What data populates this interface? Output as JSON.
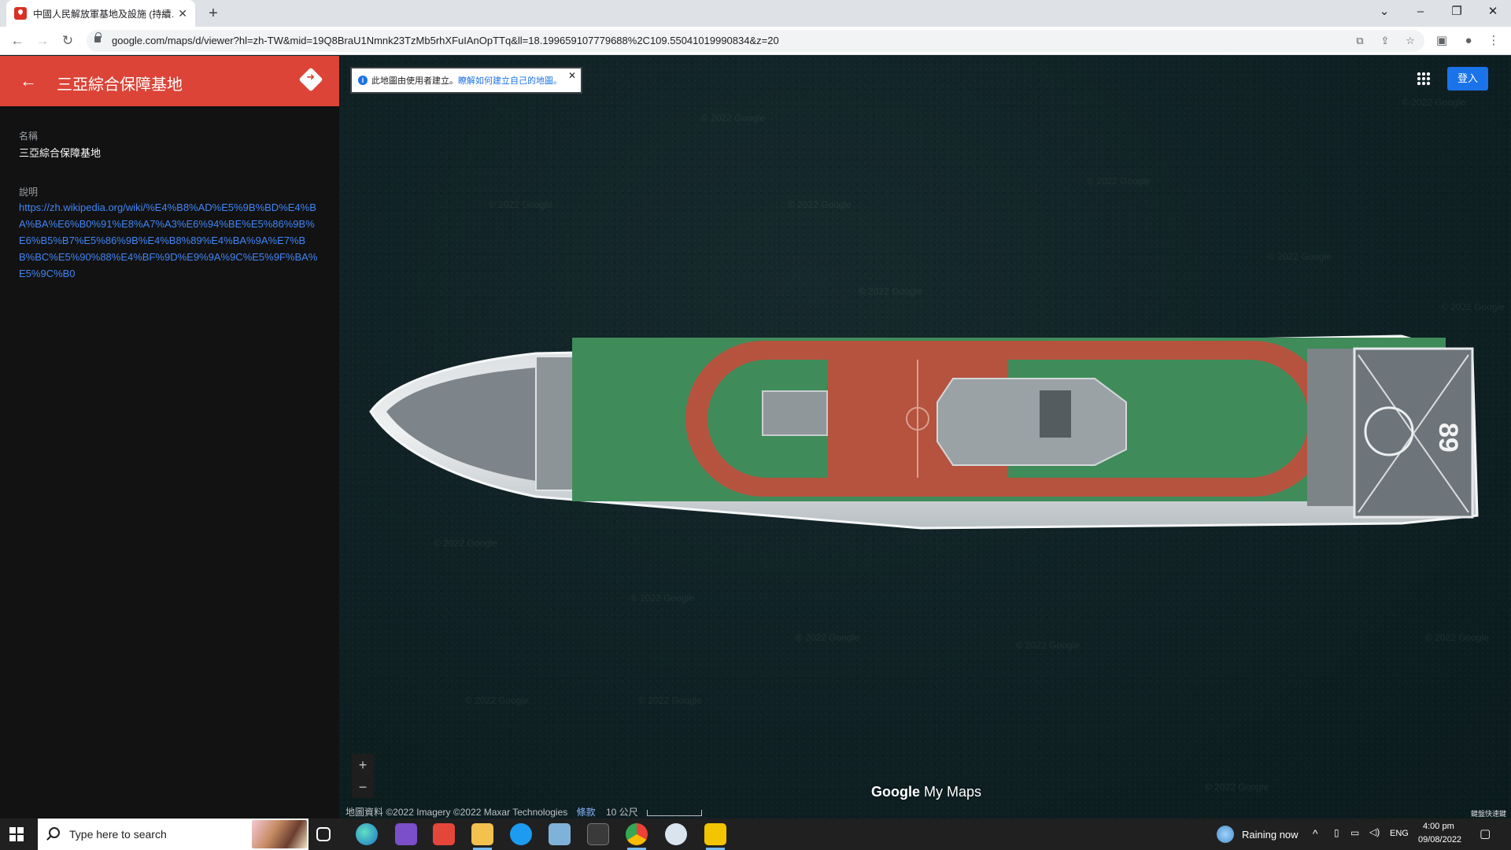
{
  "browser": {
    "tab_title": "中國人民解放軍基地及設施 (持續…",
    "url": "google.com/maps/d/viewer?hl=zh-TW&mid=19Q8BraU1Nmnk23TzMb5rhXFuIAnOpTTq&ll=18.199659107779688%2C109.55041019990834&z=20"
  },
  "panel": {
    "title": "三亞綜合保障基地",
    "name_label": "名稱",
    "name_value": "三亞綜合保障基地",
    "desc_label": "說明",
    "desc_link": "https://zh.wikipedia.org/wiki/%E4%B8%AD%E5%9B%BD%E4%BA%BA%E6%B0%91%E8%A7%A3%E6%94%BE%E5%86%9B%E6%B5%B7%E5%86%9B%E4%B8%89%E4%BA%9A%E7%BB%BC%E5%90%88%E4%BF%9D%E9%9A%9C%E5%9F%BA%E5%9C%B0"
  },
  "map": {
    "notice_text": "此地圖由使用者建立。",
    "notice_link": "瞭解如何建立自己的地圖。",
    "signin_label": "登入",
    "watermark_text": "© 2022 Google",
    "zoom_in": "+",
    "zoom_out": "−",
    "logo_google": "Google",
    "logo_mymaps": "My Maps",
    "attribution": "地圖資料 ©2022 Imagery ©2022 Maxar Technologies",
    "terms": "條款",
    "scale": "10 公尺",
    "corner_text": "鍵盤快速鍵",
    "hull_number": "89"
  },
  "taskbar": {
    "search_placeholder": "Type here to search",
    "weather": "Raining now",
    "lang": "ENG",
    "time": "4:00 pm",
    "date": "09/08/2022"
  },
  "colors": {
    "panel_header": "#db4437",
    "link": "#4285f4",
    "signin": "#1a73e8"
  }
}
